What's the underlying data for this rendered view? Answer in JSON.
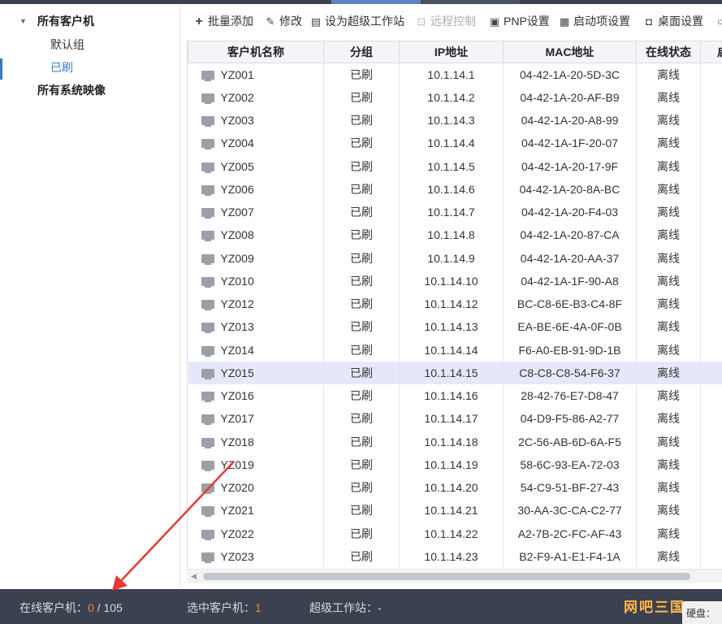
{
  "sidebar": {
    "root_all_clients": "所有客户机",
    "group_default": "默认组",
    "group_flashed": "已刷",
    "root_all_images": "所有系统映像"
  },
  "toolbar": {
    "batch_add": "批量添加",
    "modify": "修改",
    "set_super": "设为超级工作站",
    "remote_control": "远程控制",
    "pnp": "PNP设置",
    "boot_items": "启动项设置",
    "desktop": "桌面设置"
  },
  "table": {
    "headers": [
      "客户机名称",
      "分组",
      "IP地址",
      "MAC地址",
      "在线状态",
      "启动"
    ],
    "rows": [
      {
        "name": "YZ001",
        "group": "已刷",
        "ip": "10.1.14.1",
        "mac": "04-42-1A-20-5D-3C",
        "status": "离线"
      },
      {
        "name": "YZ002",
        "group": "已刷",
        "ip": "10.1.14.2",
        "mac": "04-42-1A-20-AF-B9",
        "status": "离线"
      },
      {
        "name": "YZ003",
        "group": "已刷",
        "ip": "10.1.14.3",
        "mac": "04-42-1A-20-A8-99",
        "status": "离线"
      },
      {
        "name": "YZ004",
        "group": "已刷",
        "ip": "10.1.14.4",
        "mac": "04-42-1A-1F-20-07",
        "status": "离线"
      },
      {
        "name": "YZ005",
        "group": "已刷",
        "ip": "10.1.14.5",
        "mac": "04-42-1A-20-17-9F",
        "status": "离线"
      },
      {
        "name": "YZ006",
        "group": "已刷",
        "ip": "10.1.14.6",
        "mac": "04-42-1A-20-8A-BC",
        "status": "离线"
      },
      {
        "name": "YZ007",
        "group": "已刷",
        "ip": "10.1.14.7",
        "mac": "04-42-1A-20-F4-03",
        "status": "离线"
      },
      {
        "name": "YZ008",
        "group": "已刷",
        "ip": "10.1.14.8",
        "mac": "04-42-1A-20-87-CA",
        "status": "离线"
      },
      {
        "name": "YZ009",
        "group": "已刷",
        "ip": "10.1.14.9",
        "mac": "04-42-1A-20-AA-37",
        "status": "离线"
      },
      {
        "name": "YZ010",
        "group": "已刷",
        "ip": "10.1.14.10",
        "mac": "04-42-1A-1F-90-A8",
        "status": "离线"
      },
      {
        "name": "YZ012",
        "group": "已刷",
        "ip": "10.1.14.12",
        "mac": "BC-C8-6E-B3-C4-8F",
        "status": "离线"
      },
      {
        "name": "YZ013",
        "group": "已刷",
        "ip": "10.1.14.13",
        "mac": "EA-BE-6E-4A-0F-0B",
        "status": "离线"
      },
      {
        "name": "YZ014",
        "group": "已刷",
        "ip": "10.1.14.14",
        "mac": "F6-A0-EB-91-9D-1B",
        "status": "离线"
      },
      {
        "name": "YZ015",
        "group": "已刷",
        "ip": "10.1.14.15",
        "mac": "C8-C8-C8-54-F6-37",
        "status": "离线",
        "selected": true
      },
      {
        "name": "YZ016",
        "group": "已刷",
        "ip": "10.1.14.16",
        "mac": "28-42-76-E7-D8-47",
        "status": "离线"
      },
      {
        "name": "YZ017",
        "group": "已刷",
        "ip": "10.1.14.17",
        "mac": "04-D9-F5-86-A2-77",
        "status": "离线"
      },
      {
        "name": "YZ018",
        "group": "已刷",
        "ip": "10.1.14.18",
        "mac": "2C-56-AB-6D-6A-F5",
        "status": "离线"
      },
      {
        "name": "YZ019",
        "group": "已刷",
        "ip": "10.1.14.19",
        "mac": "58-6C-93-EA-72-03",
        "status": "离线"
      },
      {
        "name": "YZ020",
        "group": "已刷",
        "ip": "10.1.14.20",
        "mac": "54-C9-51-BF-27-43",
        "status": "离线"
      },
      {
        "name": "YZ021",
        "group": "已刷",
        "ip": "10.1.14.21",
        "mac": "30-AA-3C-CA-C2-77",
        "status": "离线"
      },
      {
        "name": "YZ022",
        "group": "已刷",
        "ip": "10.1.14.22",
        "mac": "A2-7B-2C-FC-AF-43",
        "status": "离线"
      },
      {
        "name": "YZ023",
        "group": "已刷",
        "ip": "10.1.14.23",
        "mac": "B2-F9-A1-E1-F4-1A",
        "status": "离线"
      }
    ]
  },
  "statusbar": {
    "online_label": "在线客户机：",
    "online_count": "0",
    "online_total": " / 105",
    "selected_label": "选中客户机：",
    "selected_count": "1",
    "super_label": "超级工作站：",
    "super_value": "-",
    "watermark": "网吧三国",
    "disk_label": "硬盘："
  },
  "colors": {
    "accent": "#3a78c3",
    "status_bar_bg": "#3c4150",
    "highlight_number": "#e08a2f",
    "selected_row": "#e6e8fa",
    "annotation_arrow": "#e53935"
  },
  "icons": {
    "batch_add": "plus-icon",
    "modify": "pencil-icon",
    "set_super": "document-icon",
    "remote_control": "remote-icon",
    "pnp": "chip-icon",
    "boot_items": "boot-icon",
    "desktop": "desktop-icon",
    "client": "monitor-icon"
  }
}
